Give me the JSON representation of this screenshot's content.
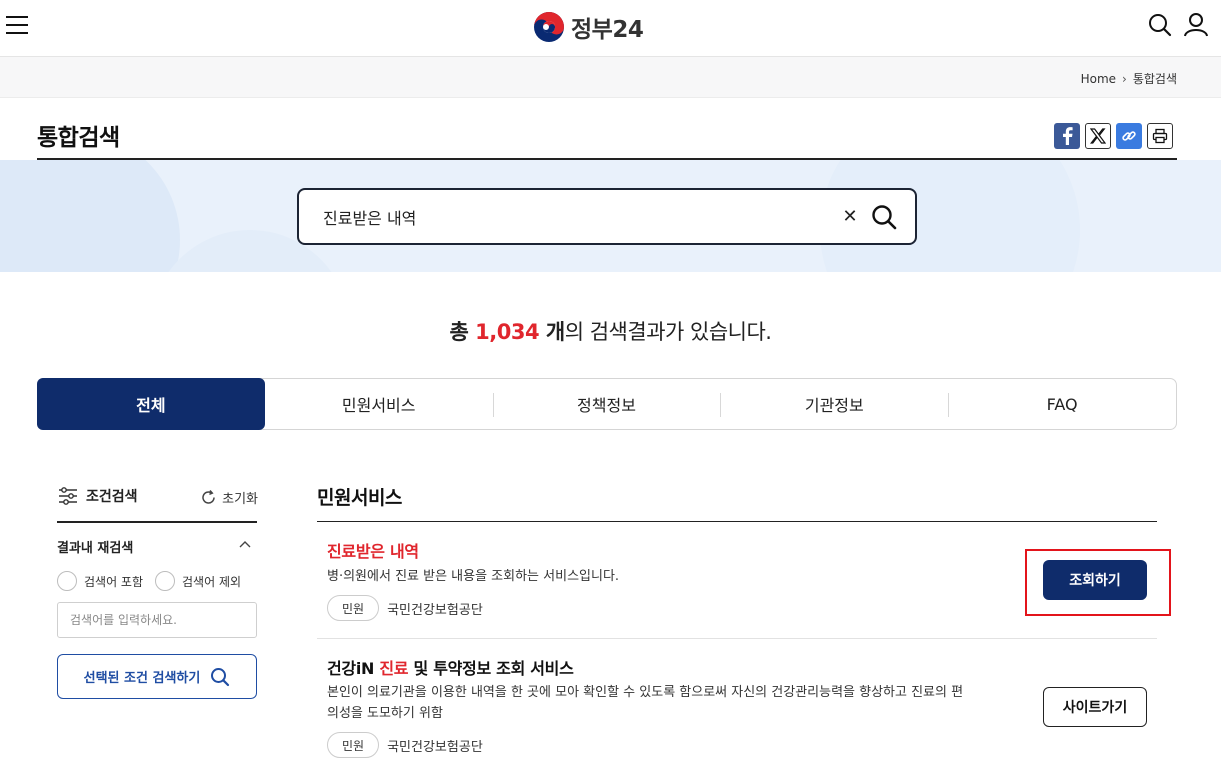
{
  "header": {
    "logo_text": "정부24",
    "icons": [
      "menu-icon",
      "search-icon",
      "user-icon"
    ]
  },
  "breadcrumb": {
    "home": "Home",
    "current": "통합검색"
  },
  "page": {
    "title": "통합검색"
  },
  "share": {
    "icons": [
      "facebook-icon",
      "x-icon",
      "link-icon",
      "print-icon"
    ]
  },
  "search": {
    "value": "진료받은 내역"
  },
  "result_summary": {
    "prefix": "총 ",
    "count": "1,034",
    "unit": " 개",
    "suffix": "의 검색결과가 있습니다."
  },
  "tabs": [
    {
      "label": "전체",
      "active": true
    },
    {
      "label": "민원서비스",
      "active": false
    },
    {
      "label": "정책정보",
      "active": false
    },
    {
      "label": "기관정보",
      "active": false
    },
    {
      "label": "FAQ",
      "active": false
    }
  ],
  "sidebar": {
    "filter_title": "조건검색",
    "reset_label": "초기화",
    "refine_title": "결과내 재검색",
    "include_label": "검색어 포함",
    "exclude_label": "검색어 제외",
    "refine_placeholder": "검색어를 입력하세요.",
    "search_button": "선택된 조건 검색하기"
  },
  "main": {
    "section_title": "민원서비스",
    "results": [
      {
        "title": "진료받은 내역",
        "description": "병·의원에서 진료 받은 내용을 조회하는 서비스입니다.",
        "category": "민원",
        "agency": "국민건강보험공단",
        "action": "조회하기"
      },
      {
        "title_before": "건강iN ",
        "title_highlight": "진료",
        "title_after": " 및 투약정보 조회 서비스",
        "description_line1": "본인이 의료기관을 이용한 내역을 한 곳에 모아 확인할 수 있도록 함으로써 자신의 건강관리능력을 향상하고 진료의 편",
        "description_line2": "의성을 도모하기 위함",
        "category": "민원",
        "agency": "국민건강보험공단",
        "action": "사이트가기"
      }
    ]
  },
  "colors": {
    "brand_navy": "#0f2c6b",
    "highlight_red": "#e0262d",
    "search_band": "#e9f1fb"
  }
}
